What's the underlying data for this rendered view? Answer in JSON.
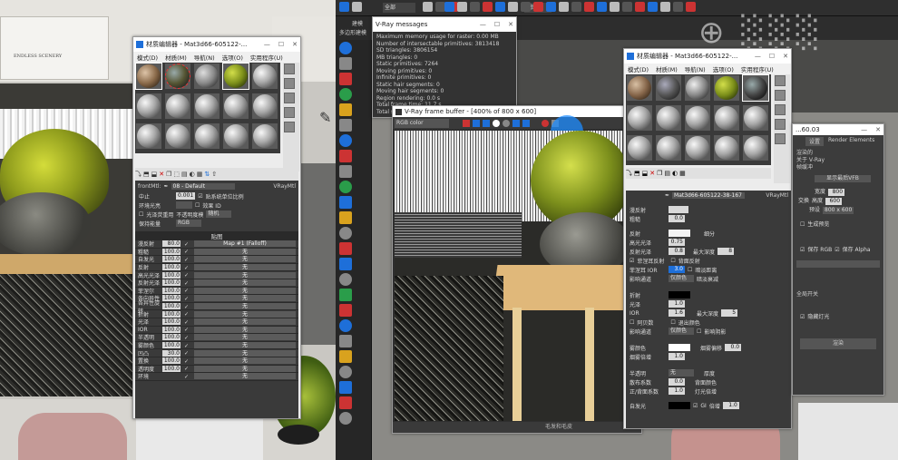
{
  "colors": {
    "accent": "#1e6fd9",
    "viewport": "#2a2a2a"
  },
  "left_scene": {
    "poster_text": "ENDLESS SCENERY"
  },
  "mat_editor_left": {
    "title": "材质编辑器 - Mat3d66-605122-...",
    "menu": [
      "模式(D)",
      "材质(M)",
      "导航(N)",
      "选项(O)",
      "实用程序(U)"
    ],
    "front_label": "frontMtl:",
    "map_name": "08 - Default",
    "type_name": "VRayMtl",
    "opts": {
      "r1_label": "中止",
      "r1_val": "0.001",
      "r1_check": "贴系统单位比例",
      "r2_label": "环境光亮",
      "r2_check": "效果 ID",
      "r3_check": "光泽荧重用",
      "r3_check2": "不透明度模",
      "r3_dd": "随机",
      "r4_label": "保持能量",
      "r4_dd": "RGB"
    },
    "section_title": "贴图",
    "maps": [
      {
        "label": "漫反射",
        "value": "80.0",
        "map": "Map #1 (Falloff)"
      },
      {
        "label": "粗糙",
        "value": "100.0",
        "map": "无"
      },
      {
        "label": "自发光",
        "value": "100.0",
        "map": "无"
      },
      {
        "label": "反射",
        "value": "100.0",
        "map": "无"
      },
      {
        "label": "高光光泽",
        "value": "100.0",
        "map": "无"
      },
      {
        "label": "反射光泽",
        "value": "100.0",
        "map": "无"
      },
      {
        "label": "菲涅尔",
        "value": "100.0",
        "map": "无"
      },
      {
        "label": "各向异性",
        "value": "100.0",
        "map": "无"
      },
      {
        "label": "各异性旋转",
        "value": "100.0",
        "map": "无"
      },
      {
        "label": "折射",
        "value": "100.0",
        "map": "无"
      },
      {
        "label": "光泽",
        "value": "100.0",
        "map": "无"
      },
      {
        "label": "IOR",
        "value": "100.0",
        "map": "无"
      },
      {
        "label": "半透明",
        "value": "100.0",
        "map": "无"
      },
      {
        "label": "雾颜色",
        "value": "100.0",
        "map": "无"
      },
      {
        "label": "凹凸",
        "value": "30.0",
        "map": "无"
      },
      {
        "label": "置换",
        "value": "100.0",
        "map": "无"
      },
      {
        "label": "透明度",
        "value": "100.0",
        "map": "无"
      },
      {
        "label": "环境",
        "value": "",
        "map": "无"
      }
    ]
  },
  "top_toolbar": {
    "dropdown1": "全部",
    "dropdown2": "视图",
    "panel_tab1": "建模",
    "panel_tab2": "多边形建模"
  },
  "vray_messages": {
    "title": "V-Ray messages",
    "lines": [
      "Maximum memory usage for raster: 0.00 MB",
      "Number of intersectable primitives: 3813418",
      "SD triangles: 3806154",
      "MB triangles: 0",
      "Static primitives: 7264",
      "Moving primitives: 0",
      "Infinite primitives: 0",
      "Static hair segments: 0",
      "Moving hair segments: 0",
      "Region rendering: 0.0 s",
      "Total frame time: 11.7 s",
      "Total sequence time: 12.5 s"
    ]
  },
  "frame_buffer": {
    "title": "V-Ray frame buffer - [400% of 800 x 600]",
    "channel": "RGB color",
    "status": "毛发和毛皮"
  },
  "mat_editor_right": {
    "title": "材质编辑器 - Mat3d66-605122-...",
    "menu": [
      "模式(D)",
      "材质(M)",
      "导航(N)",
      "选项(O)",
      "实用程序(U)"
    ],
    "map_name": "Mat3d66-605122-38-167",
    "type_name": "VRayMtl",
    "diffuse_label": "漫反射",
    "rough_label": "粗糙",
    "rough_val": "0.0",
    "refl_label": "反射",
    "hgloss_label": "高光光泽",
    "hgloss_val": "0.75",
    "rgloss_label": "反射光泽",
    "rgloss_val": "0.8",
    "subdiv_label": "细分",
    "subdiv_val": "8",
    "maxdepth_label": "最大深度",
    "maxdepth_val": "5",
    "backrefl": "背面反射",
    "fresnel": "菲涅耳反射",
    "fresnel_ior": "菲涅耳 IOR",
    "fresnel_ior_val": "3.0",
    "dimdist": "暗淡距离",
    "affect": "影响通道",
    "affect_dd": "仅颜色",
    "dimfall": "暗淡衰减",
    "refr_label": "折射",
    "gloss_label": "光泽",
    "gloss_val": "1.0",
    "ior_label": "IOR",
    "ior_val": "1.6",
    "abbe": "阿贝数",
    "affshadow": "影响阴影",
    "exitcolor": "退出颜色",
    "fog_label": "雾颜色",
    "fogmult_label": "烟雾倍增",
    "fogmult_val": "1.0",
    "fogbias_label": "烟雾偏移",
    "fogbias_val": "0.0",
    "transl_label": "半透明",
    "transl_dd": "无",
    "scatter_label": "散布系数",
    "scatter_val": "0.0",
    "fbc_label": "正/背面系数",
    "fbc_val": "1.0",
    "thickness_label": "厚度",
    "backside": "背面颜色",
    "light_mult": "灯光倍增",
    "selfillum_label": "自发光",
    "gi": "GI",
    "mult_label": "倍增",
    "mult_val": "1.0"
  },
  "render_setup": {
    "title": "...60.03",
    "tabs": [
      "设置",
      "Render Elements"
    ],
    "items": [
      "渲染的",
      "关于 V-Ray",
      "帧缓冲",
      "显示最后VFB"
    ],
    "width_label": "宽度",
    "width_val": "800",
    "height_label": "高度",
    "height_val": "600",
    "swap": "交换",
    "preset_label": "预设",
    "preset_val": "800 x 600",
    "gen_preview": "生成预览",
    "save_rgb": "保存 RGB",
    "save_alpha": "保存 Alpha",
    "switch_label": "全局开关",
    "hidden_lights": "隐藏灯光",
    "render_btn": "渲染"
  }
}
